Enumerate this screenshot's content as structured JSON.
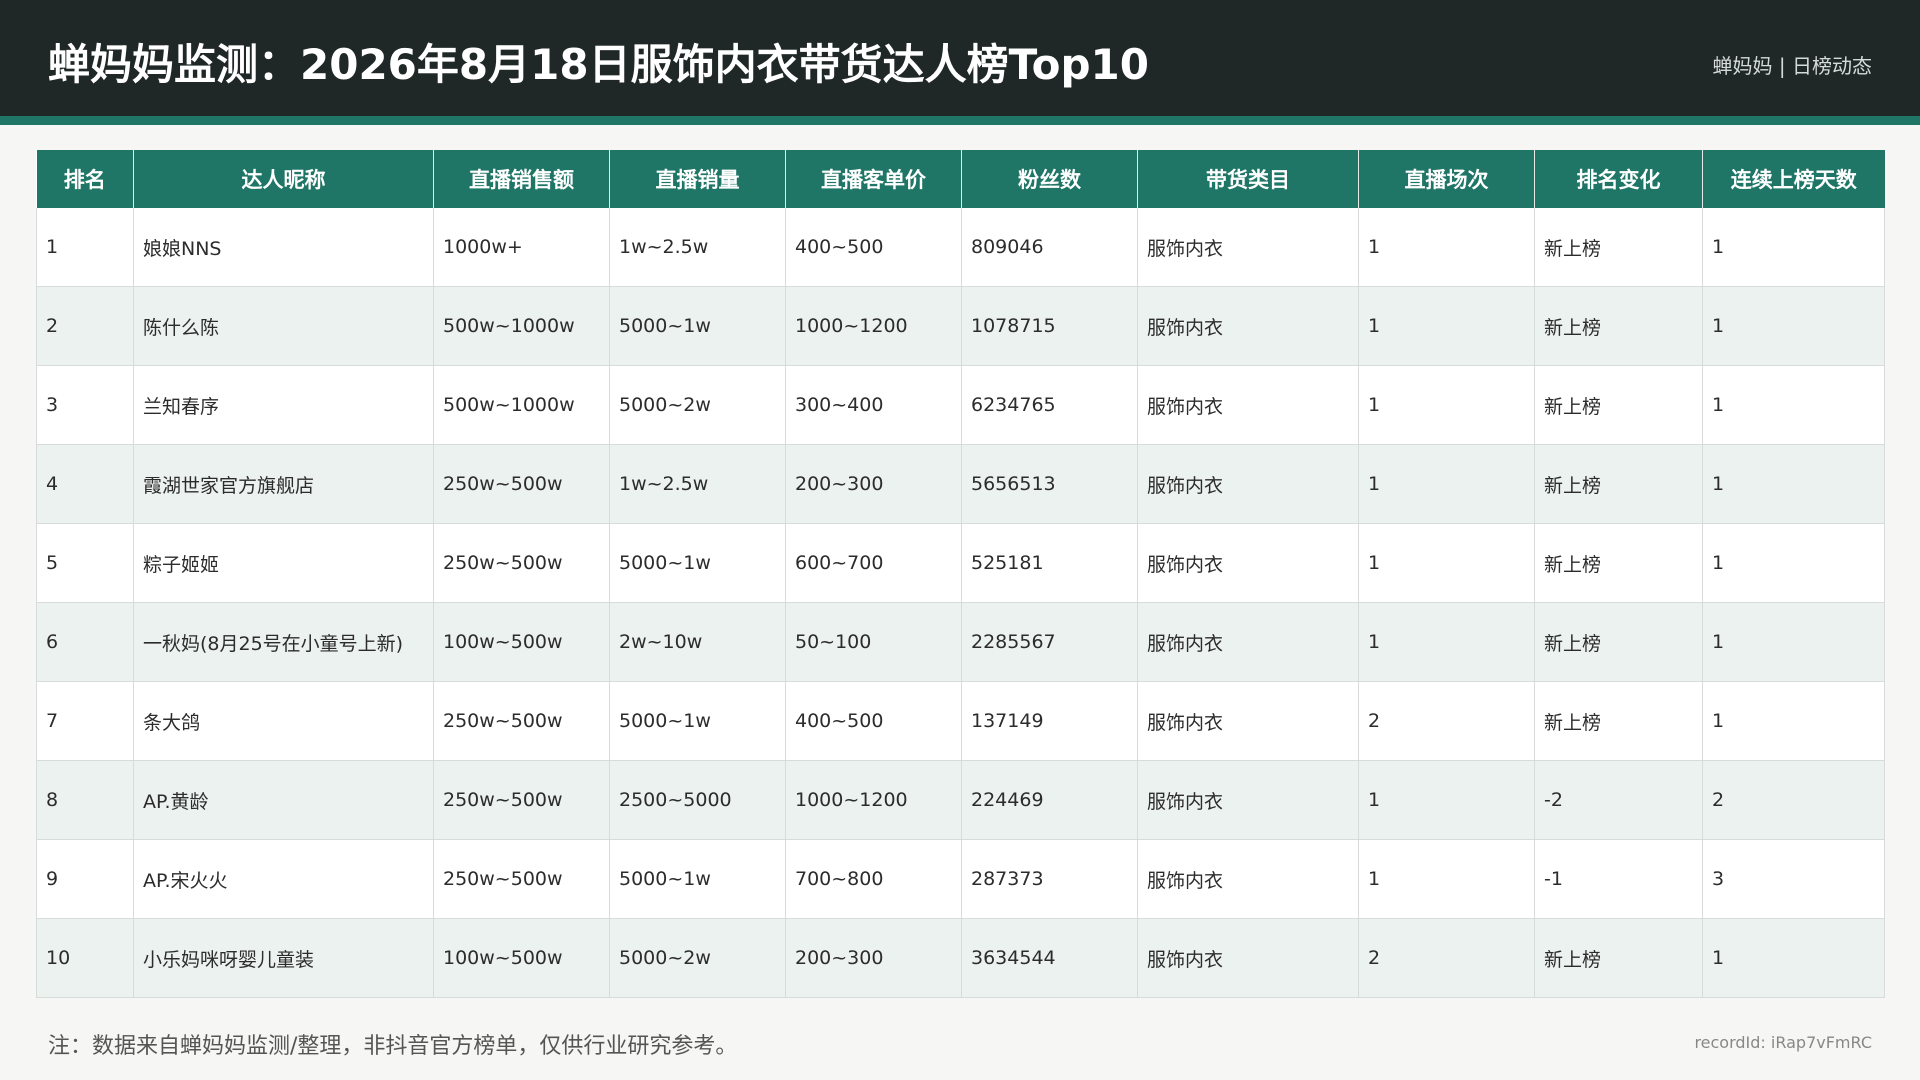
{
  "header": {
    "title": "蝉妈妈监测：2026年8月18日服饰内衣带货达人榜Top10",
    "brand": "蝉妈妈 | 日榜动态"
  },
  "table": {
    "columns": [
      "排名",
      "达人昵称",
      "直播销售额",
      "直播销量",
      "直播客单价",
      "粉丝数",
      "带货类目",
      "直播场次",
      "排名变化",
      "连续上榜天数"
    ],
    "rows": [
      [
        "1",
        "娘娘NNS",
        "1000w+",
        "1w~2.5w",
        "400~500",
        "809046",
        "服饰内衣",
        "1",
        "新上榜",
        "1"
      ],
      [
        "2",
        "陈什么陈",
        "500w~1000w",
        "5000~1w",
        "1000~1200",
        "1078715",
        "服饰内衣",
        "1",
        "新上榜",
        "1"
      ],
      [
        "3",
        "兰知春序",
        "500w~1000w",
        "5000~2w",
        "300~400",
        "6234765",
        "服饰内衣",
        "1",
        "新上榜",
        "1"
      ],
      [
        "4",
        "霞湖世家官方旗舰店",
        "250w~500w",
        "1w~2.5w",
        "200~300",
        "5656513",
        "服饰内衣",
        "1",
        "新上榜",
        "1"
      ],
      [
        "5",
        "粽子姬姬",
        "250w~500w",
        "5000~1w",
        "600~700",
        "525181",
        "服饰内衣",
        "1",
        "新上榜",
        "1"
      ],
      [
        "6",
        "一秋妈(8月25号在小童号上新)",
        "100w~500w",
        "2w~10w",
        "50~100",
        "2285567",
        "服饰内衣",
        "1",
        "新上榜",
        "1"
      ],
      [
        "7",
        "条大鸽",
        "250w~500w",
        "5000~1w",
        "400~500",
        "137149",
        "服饰内衣",
        "2",
        "新上榜",
        "1"
      ],
      [
        "8",
        "AP.黄龄",
        "250w~500w",
        "2500~5000",
        "1000~1200",
        "224469",
        "服饰内衣",
        "1",
        "-2",
        "2"
      ],
      [
        "9",
        "AP.宋火火",
        "250w~500w",
        "5000~1w",
        "700~800",
        "287373",
        "服饰内衣",
        "1",
        "-1",
        "3"
      ],
      [
        "10",
        "小乐妈咪呀婴儿童装",
        "100w~500w",
        "5000~2w",
        "200~300",
        "3634544",
        "服饰内衣",
        "2",
        "新上榜",
        "1"
      ]
    ]
  },
  "footer": {
    "note": "注：数据来自蝉妈妈监测/整理，非抖音官方榜单，仅供行业研究参考。",
    "record_id": "recordId: iRap7vFmRC"
  },
  "colors": {
    "header_bg": "#1f2826",
    "accent": "#1f7666",
    "row_alt": "#ebf2ef"
  }
}
